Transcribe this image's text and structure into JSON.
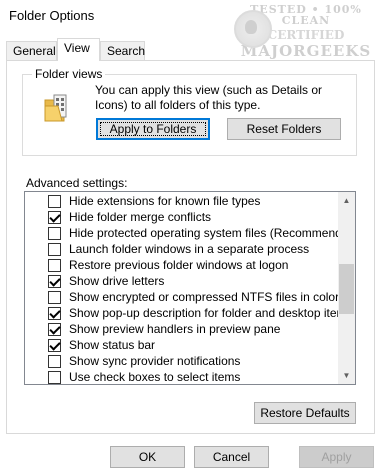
{
  "window": {
    "title": "Folder Options"
  },
  "watermark": {
    "line1": "TESTED • 100% CLEAN",
    "line2": "CERTIFIED",
    "line3": "MAJORGEEKS",
    "stars": "★★★★★★★★"
  },
  "tabs": [
    {
      "label": "General",
      "active": false
    },
    {
      "label": "View",
      "active": true
    },
    {
      "label": "Search",
      "active": false
    }
  ],
  "folder_views": {
    "group_label": "Folder views",
    "description": "You can apply this view (such as Details or Icons) to all folders of this type.",
    "apply_label": "Apply to Folders",
    "reset_label": "Reset Folders"
  },
  "advanced": {
    "label": "Advanced settings:",
    "items": [
      {
        "label": "Hide extensions for known file types",
        "checked": false
      },
      {
        "label": "Hide folder merge conflicts",
        "checked": true
      },
      {
        "label": "Hide protected operating system files (Recommended)",
        "checked": false
      },
      {
        "label": "Launch folder windows in a separate process",
        "checked": false
      },
      {
        "label": "Restore previous folder windows at logon",
        "checked": false
      },
      {
        "label": "Show drive letters",
        "checked": true
      },
      {
        "label": "Show encrypted or compressed NTFS files in color",
        "checked": false
      },
      {
        "label": "Show pop-up description for folder and desktop items",
        "checked": true
      },
      {
        "label": "Show preview handlers in preview pane",
        "checked": true
      },
      {
        "label": "Show status bar",
        "checked": true
      },
      {
        "label": "Show sync provider notifications",
        "checked": false
      },
      {
        "label": "Use check boxes to select items",
        "checked": false
      }
    ],
    "scroll_up": "▲",
    "scroll_down": "▼"
  },
  "restore_defaults_label": "Restore Defaults",
  "footer": {
    "ok_label": "OK",
    "cancel_label": "Cancel",
    "apply_label": "Apply"
  }
}
